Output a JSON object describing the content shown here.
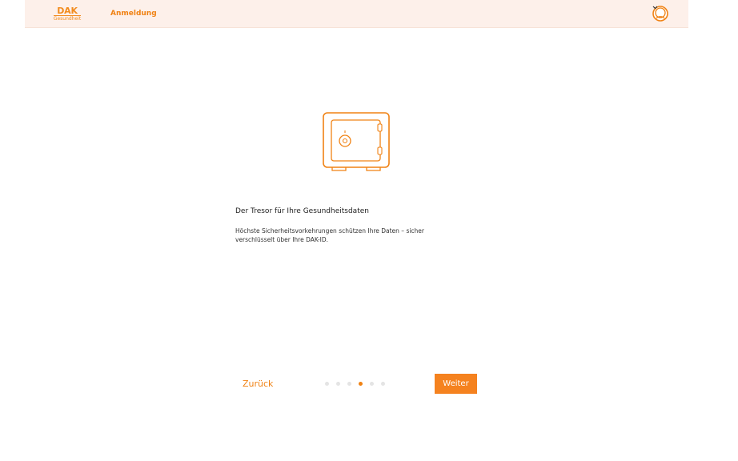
{
  "header": {
    "logo_word": "DAK",
    "logo_sub": "Gesundheit",
    "title": "Anmeldung",
    "user_icon": "user-avatar-icon",
    "chevron_icon": "chevron-down-icon"
  },
  "main": {
    "illustration_icon": "safe-icon",
    "title": "Der Tresor für Ihre Gesundheitsdaten",
    "text": "Höchste Sicherheitsvorkehrungen schützen Ihre Daten – sicher verschlüsselt über Ihre DAK-ID."
  },
  "navigation": {
    "back_label": "Zurück",
    "next_label": "Weiter",
    "total_steps": 6,
    "current_step": 4
  },
  "colors": {
    "accent": "#f08214",
    "header_bg": "#fdf0ea",
    "button_bg": "#f5821f",
    "dot_inactive": "#e4e4e4"
  }
}
